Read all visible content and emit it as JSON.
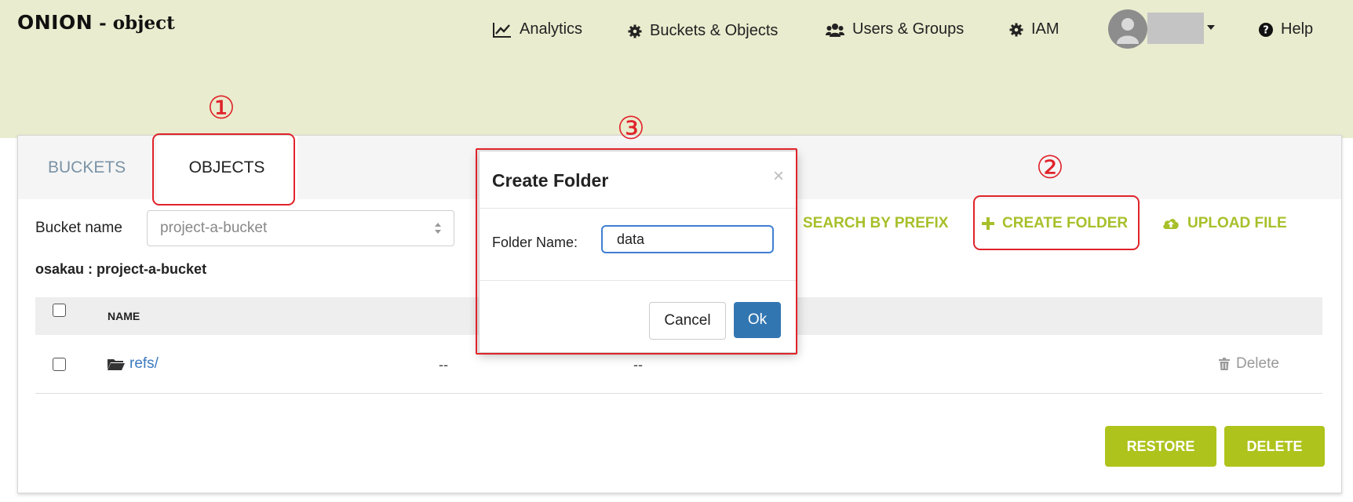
{
  "app": {
    "logo_brand": "ONION",
    "logo_suffix": " - object"
  },
  "nav": {
    "analytics": "Analytics",
    "buckets_objects": "Buckets & Objects",
    "users_groups": "Users & Groups",
    "iam": "IAM",
    "help": "Help"
  },
  "tabs": {
    "buckets": "BUCKETS",
    "objects": "OBJECTS"
  },
  "bucket": {
    "label": "Bucket name",
    "selected": "project-a-bucket",
    "path": "osakau : project-a-bucket"
  },
  "actions": {
    "search_prefix": "SEARCH BY PREFIX",
    "create_folder": "CREATE FOLDER",
    "upload_file": "UPLOAD FILE"
  },
  "table": {
    "header_name": "NAME",
    "rows": [
      {
        "name": "refs/",
        "col2": "--",
        "col3": "--",
        "delete": "Delete"
      }
    ]
  },
  "footer_buttons": {
    "restore": "RESTORE",
    "delete": "DELETE"
  },
  "modal": {
    "title": "Create Folder",
    "close": "×",
    "label": "Folder Name:",
    "value": "data",
    "cancel": "Cancel",
    "ok": "Ok"
  },
  "annotations": {
    "marker1": "①",
    "marker2": "②",
    "marker3": "③"
  },
  "colors": {
    "header_bg": "#e9ecce",
    "accent_green": "#aec31c",
    "link_blue": "#3a7abf",
    "ok_blue": "#3276b1",
    "highlight_red": "#e0232a"
  },
  "icons": {
    "analytics": "chart-line-icon",
    "buckets": "gear-icon",
    "users": "users-icon",
    "iam": "gear-icon",
    "help": "question-circle-icon",
    "create": "plus-icon",
    "upload": "cloud-upload-icon",
    "folder": "folder-icon",
    "delete": "trash-icon"
  }
}
